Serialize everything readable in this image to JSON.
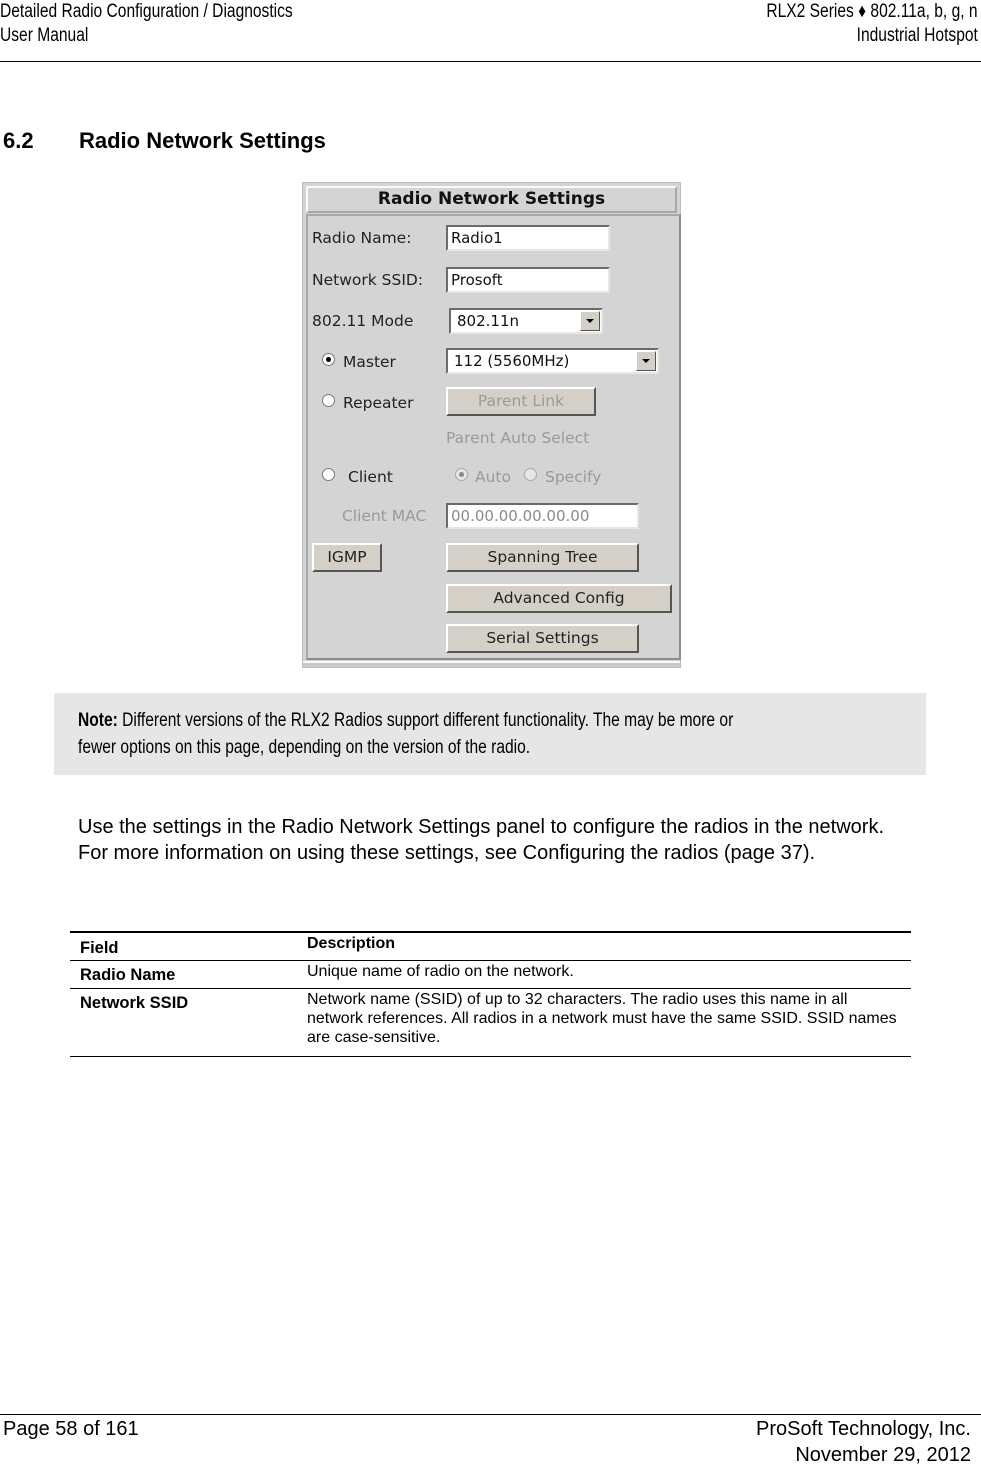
{
  "header": {
    "left_line1": "Detailed Radio Configuration / Diagnostics",
    "left_line2": "User Manual",
    "right_line1": "RLX2 Series ♦ 802.11a, b, g, n",
    "right_line2": "Industrial Hotspot"
  },
  "section": {
    "number": "6.2",
    "title": "Radio Network Settings"
  },
  "panel": {
    "title": "Radio Network Settings",
    "radio_name_label": "Radio Name:",
    "radio_name_value": "Radio1",
    "ssid_label": "Network SSID:",
    "ssid_value": "Prosoft",
    "mode_label": "802.11 Mode",
    "mode_value": "802.11n",
    "master_label": "Master",
    "master_selected": true,
    "channel_value": "112 (5560MHz)",
    "repeater_label": "Repeater",
    "parent_link_label": "Parent Link",
    "parent_auto_select_label": "Parent Auto Select",
    "client_label": "Client",
    "auto_label": "Auto",
    "specify_label": "Specify",
    "client_mac_label": "Client MAC",
    "client_mac_value": "00.00.00.00.00.00",
    "igmp_label": "IGMP",
    "spanning_tree_label": "Spanning Tree",
    "advanced_config_label": "Advanced Config",
    "serial_settings_label": "Serial Settings"
  },
  "note": {
    "prefix": "Note:",
    "line1": " Different versions of the RLX2 Radios support different functionality. The may be more or",
    "line2": "fewer options on this page, depending on the version of the radio."
  },
  "body": {
    "paragraph": "Use the settings in the Radio Network Settings panel to configure the radios in the network. For more information on using these settings, see Configuring the radios (page 37)."
  },
  "table": {
    "headers": [
      "Field",
      "Description"
    ],
    "rows": [
      {
        "field": "Radio Name",
        "description": "Unique name of radio on the network."
      },
      {
        "field": "Network SSID",
        "description": "Network name (SSID) of up to 32 characters. The radio uses this name in all network references. All radios in a network must have the same SSID. SSID names are case-sensitive."
      }
    ]
  },
  "footer": {
    "page": "Page 58 of 161",
    "company": "ProSoft Technology, Inc.",
    "date": "November 29, 2012"
  }
}
